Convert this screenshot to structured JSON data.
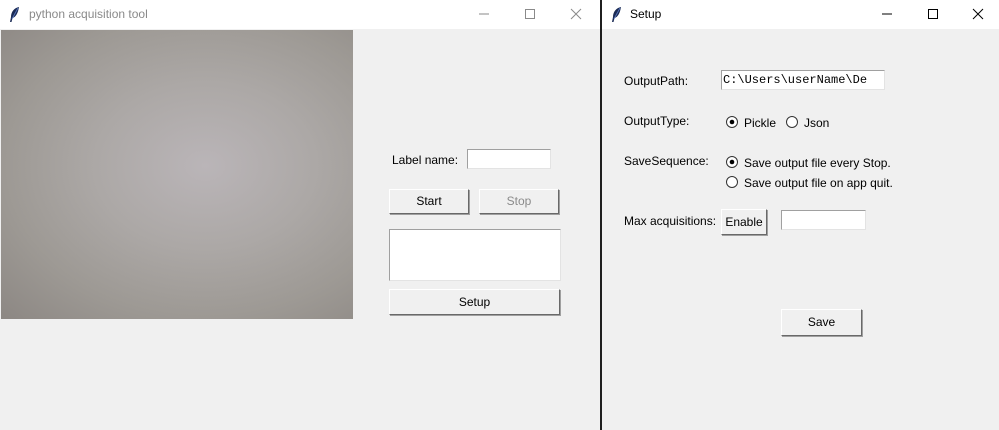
{
  "main_window": {
    "title": "python acquisition tool",
    "label_name": {
      "label": "Label name:",
      "value": ""
    },
    "start_button": "Start",
    "stop_button": "Stop",
    "log_text": "",
    "setup_button": "Setup"
  },
  "setup_window": {
    "title": "Setup",
    "output_path": {
      "label": "OutputPath:",
      "value": "C:\\Users\\userName\\De"
    },
    "output_type": {
      "label": "OutputType:",
      "options": [
        "Pickle",
        "Json"
      ],
      "selected": "Pickle"
    },
    "save_sequence": {
      "label": "SaveSequence:",
      "options": [
        "Save output file every Stop.",
        "Save output file on app quit."
      ],
      "selected": "Save output file every Stop."
    },
    "max_acquisitions": {
      "label": "Max acquisitions:",
      "button": "Enable",
      "value": ""
    },
    "save_button": "Save"
  },
  "icons": {
    "app": "feather-icon",
    "minimize": "minimize-icon",
    "maximize": "maximize-icon",
    "close": "close-icon"
  },
  "colors": {
    "window_bg": "#f0f0f0",
    "titlebar_bg": "#ffffff",
    "inactive_title": "#8a8a8a",
    "disabled_text": "#8a8a8a"
  }
}
